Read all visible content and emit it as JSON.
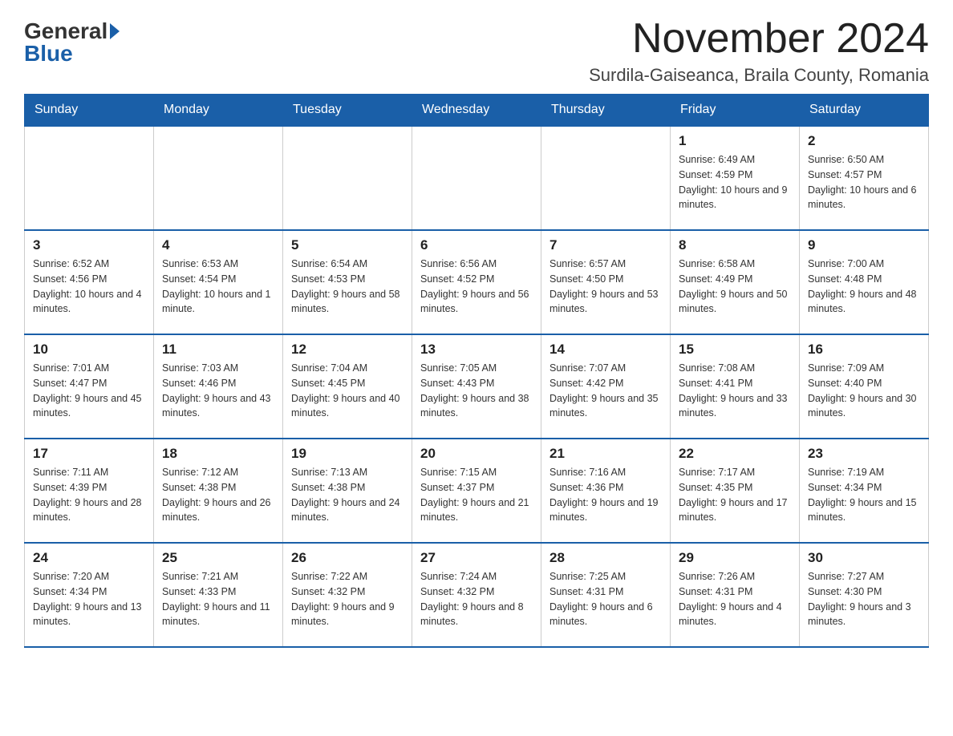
{
  "header": {
    "logo_general": "General",
    "logo_blue": "Blue",
    "month_title": "November 2024",
    "location": "Surdila-Gaiseanca, Braila County, Romania"
  },
  "days_of_week": [
    "Sunday",
    "Monday",
    "Tuesday",
    "Wednesday",
    "Thursday",
    "Friday",
    "Saturday"
  ],
  "weeks": [
    [
      {
        "day": "",
        "info": ""
      },
      {
        "day": "",
        "info": ""
      },
      {
        "day": "",
        "info": ""
      },
      {
        "day": "",
        "info": ""
      },
      {
        "day": "",
        "info": ""
      },
      {
        "day": "1",
        "info": "Sunrise: 6:49 AM\nSunset: 4:59 PM\nDaylight: 10 hours and 9 minutes."
      },
      {
        "day": "2",
        "info": "Sunrise: 6:50 AM\nSunset: 4:57 PM\nDaylight: 10 hours and 6 minutes."
      }
    ],
    [
      {
        "day": "3",
        "info": "Sunrise: 6:52 AM\nSunset: 4:56 PM\nDaylight: 10 hours and 4 minutes."
      },
      {
        "day": "4",
        "info": "Sunrise: 6:53 AM\nSunset: 4:54 PM\nDaylight: 10 hours and 1 minute."
      },
      {
        "day": "5",
        "info": "Sunrise: 6:54 AM\nSunset: 4:53 PM\nDaylight: 9 hours and 58 minutes."
      },
      {
        "day": "6",
        "info": "Sunrise: 6:56 AM\nSunset: 4:52 PM\nDaylight: 9 hours and 56 minutes."
      },
      {
        "day": "7",
        "info": "Sunrise: 6:57 AM\nSunset: 4:50 PM\nDaylight: 9 hours and 53 minutes."
      },
      {
        "day": "8",
        "info": "Sunrise: 6:58 AM\nSunset: 4:49 PM\nDaylight: 9 hours and 50 minutes."
      },
      {
        "day": "9",
        "info": "Sunrise: 7:00 AM\nSunset: 4:48 PM\nDaylight: 9 hours and 48 minutes."
      }
    ],
    [
      {
        "day": "10",
        "info": "Sunrise: 7:01 AM\nSunset: 4:47 PM\nDaylight: 9 hours and 45 minutes."
      },
      {
        "day": "11",
        "info": "Sunrise: 7:03 AM\nSunset: 4:46 PM\nDaylight: 9 hours and 43 minutes."
      },
      {
        "day": "12",
        "info": "Sunrise: 7:04 AM\nSunset: 4:45 PM\nDaylight: 9 hours and 40 minutes."
      },
      {
        "day": "13",
        "info": "Sunrise: 7:05 AM\nSunset: 4:43 PM\nDaylight: 9 hours and 38 minutes."
      },
      {
        "day": "14",
        "info": "Sunrise: 7:07 AM\nSunset: 4:42 PM\nDaylight: 9 hours and 35 minutes."
      },
      {
        "day": "15",
        "info": "Sunrise: 7:08 AM\nSunset: 4:41 PM\nDaylight: 9 hours and 33 minutes."
      },
      {
        "day": "16",
        "info": "Sunrise: 7:09 AM\nSunset: 4:40 PM\nDaylight: 9 hours and 30 minutes."
      }
    ],
    [
      {
        "day": "17",
        "info": "Sunrise: 7:11 AM\nSunset: 4:39 PM\nDaylight: 9 hours and 28 minutes."
      },
      {
        "day": "18",
        "info": "Sunrise: 7:12 AM\nSunset: 4:38 PM\nDaylight: 9 hours and 26 minutes."
      },
      {
        "day": "19",
        "info": "Sunrise: 7:13 AM\nSunset: 4:38 PM\nDaylight: 9 hours and 24 minutes."
      },
      {
        "day": "20",
        "info": "Sunrise: 7:15 AM\nSunset: 4:37 PM\nDaylight: 9 hours and 21 minutes."
      },
      {
        "day": "21",
        "info": "Sunrise: 7:16 AM\nSunset: 4:36 PM\nDaylight: 9 hours and 19 minutes."
      },
      {
        "day": "22",
        "info": "Sunrise: 7:17 AM\nSunset: 4:35 PM\nDaylight: 9 hours and 17 minutes."
      },
      {
        "day": "23",
        "info": "Sunrise: 7:19 AM\nSunset: 4:34 PM\nDaylight: 9 hours and 15 minutes."
      }
    ],
    [
      {
        "day": "24",
        "info": "Sunrise: 7:20 AM\nSunset: 4:34 PM\nDaylight: 9 hours and 13 minutes."
      },
      {
        "day": "25",
        "info": "Sunrise: 7:21 AM\nSunset: 4:33 PM\nDaylight: 9 hours and 11 minutes."
      },
      {
        "day": "26",
        "info": "Sunrise: 7:22 AM\nSunset: 4:32 PM\nDaylight: 9 hours and 9 minutes."
      },
      {
        "day": "27",
        "info": "Sunrise: 7:24 AM\nSunset: 4:32 PM\nDaylight: 9 hours and 8 minutes."
      },
      {
        "day": "28",
        "info": "Sunrise: 7:25 AM\nSunset: 4:31 PM\nDaylight: 9 hours and 6 minutes."
      },
      {
        "day": "29",
        "info": "Sunrise: 7:26 AM\nSunset: 4:31 PM\nDaylight: 9 hours and 4 minutes."
      },
      {
        "day": "30",
        "info": "Sunrise: 7:27 AM\nSunset: 4:30 PM\nDaylight: 9 hours and 3 minutes."
      }
    ]
  ]
}
